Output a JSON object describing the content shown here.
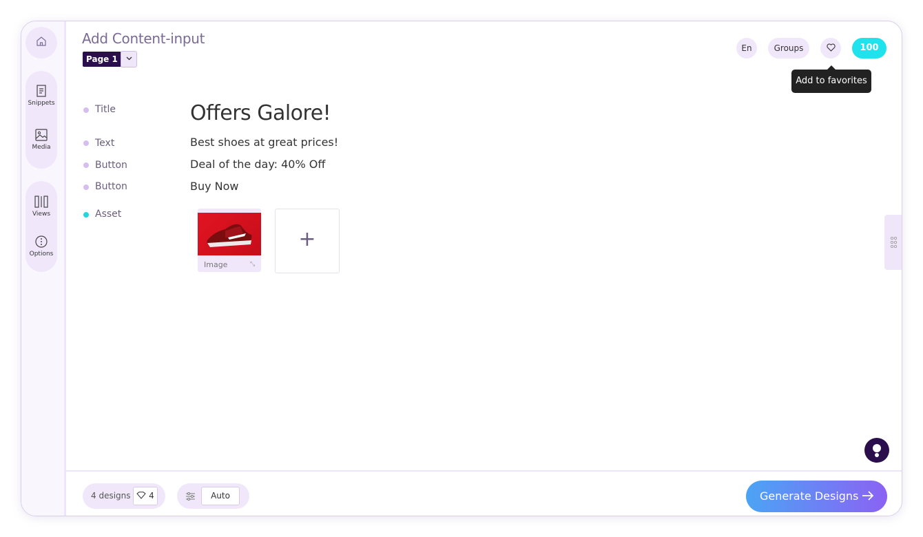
{
  "header": {
    "title": "Add Content-input",
    "page_label": "Page 1",
    "language": "En",
    "groups": "Groups",
    "credits": "100",
    "tooltip": "Add to favorites"
  },
  "sidebar": {
    "items": [
      {
        "label": "Snippets",
        "icon": "document-icon"
      },
      {
        "label": "Media",
        "icon": "image-icon"
      },
      {
        "label": "Views",
        "icon": "columns-icon"
      },
      {
        "label": "Options",
        "icon": "more-vertical-icon"
      }
    ]
  },
  "fields": [
    {
      "label": "Title",
      "value": "Offers Galore!"
    },
    {
      "label": "Text",
      "value": "Best shoes at great prices!"
    },
    {
      "label": "Button",
      "value": "Deal of the day: 40% Off"
    },
    {
      "label": "Button",
      "value": "Buy Now"
    },
    {
      "label": "Asset",
      "value": ""
    }
  ],
  "asset": {
    "caption": "Image",
    "add_symbol": "+"
  },
  "footer": {
    "designs_label": "4 designs",
    "designs_count": "4",
    "mode": "Auto",
    "generate_label": "Generate Designs"
  }
}
